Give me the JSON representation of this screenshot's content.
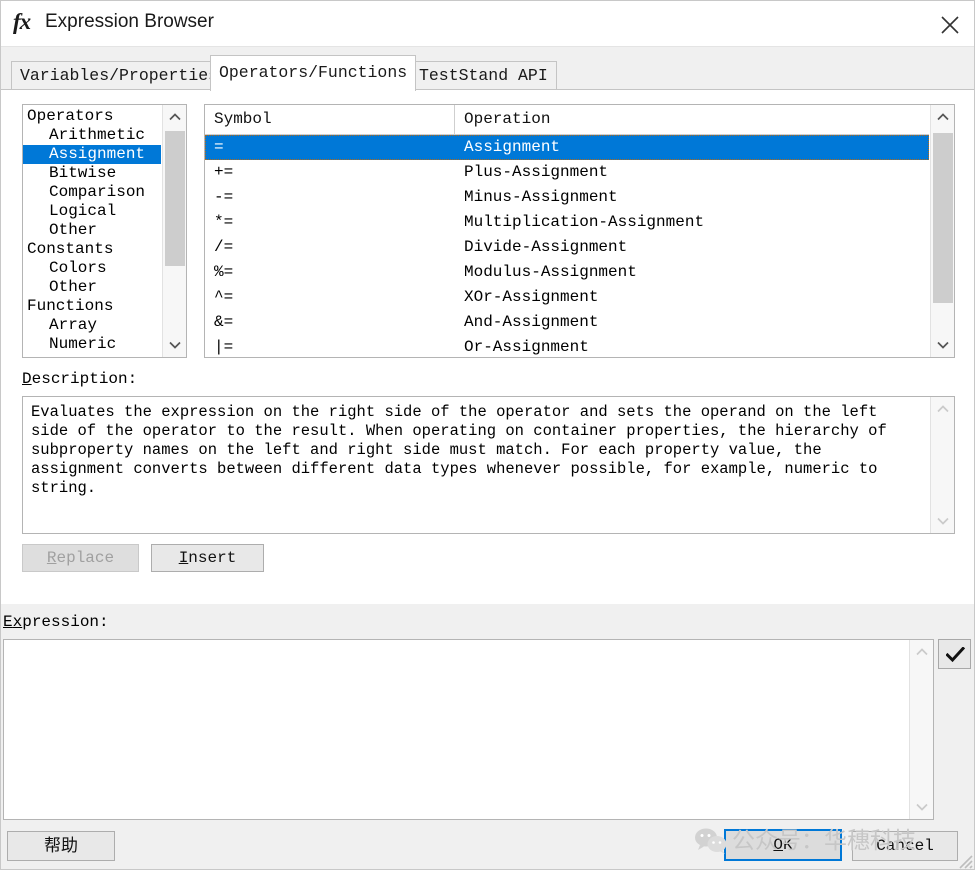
{
  "window": {
    "title": "Expression Browser",
    "fx_icon": "fx-icon",
    "close_icon": "close-icon"
  },
  "tabs": [
    {
      "label": "Variables/Properties",
      "active": false
    },
    {
      "label": "Operators/Functions",
      "active": true
    },
    {
      "label": "TestStand API",
      "active": false
    }
  ],
  "tree": {
    "items": [
      {
        "label": "Operators",
        "level": 0,
        "selected": false
      },
      {
        "label": "Arithmetic",
        "level": 1,
        "selected": false
      },
      {
        "label": "Assignment",
        "level": 1,
        "selected": true
      },
      {
        "label": "Bitwise",
        "level": 1,
        "selected": false
      },
      {
        "label": "Comparison",
        "level": 1,
        "selected": false
      },
      {
        "label": "Logical",
        "level": 1,
        "selected": false
      },
      {
        "label": "Other",
        "level": 1,
        "selected": false
      },
      {
        "label": "Constants",
        "level": 0,
        "selected": false
      },
      {
        "label": "Colors",
        "level": 1,
        "selected": false
      },
      {
        "label": "Other",
        "level": 1,
        "selected": false
      },
      {
        "label": "Functions",
        "level": 0,
        "selected": false
      },
      {
        "label": "Array",
        "level": 1,
        "selected": false
      },
      {
        "label": "Numeric",
        "level": 1,
        "selected": false
      }
    ]
  },
  "list": {
    "columns": [
      "Symbol",
      "Operation"
    ],
    "rows": [
      {
        "symbol": "=",
        "operation": "Assignment",
        "selected": true
      },
      {
        "symbol": "+=",
        "operation": "Plus-Assignment",
        "selected": false
      },
      {
        "symbol": "-=",
        "operation": "Minus-Assignment",
        "selected": false
      },
      {
        "symbol": "*=",
        "operation": "Multiplication-Assignment",
        "selected": false
      },
      {
        "symbol": "/=",
        "operation": "Divide-Assignment",
        "selected": false
      },
      {
        "symbol": "%=",
        "operation": "Modulus-Assignment",
        "selected": false
      },
      {
        "symbol": "^=",
        "operation": "XOr-Assignment",
        "selected": false
      },
      {
        "symbol": "&=",
        "operation": "And-Assignment",
        "selected": false
      },
      {
        "symbol": "|=",
        "operation": "Or-Assignment",
        "selected": false
      }
    ]
  },
  "description": {
    "label": "Description:",
    "label_accel": "D",
    "label_rest": "escription:",
    "text": "Evaluates the expression on the right side of the operator and sets the operand on the left\nside of the operator to the result. When operating on container properties, the hierarchy of\nsubproperty names on the left and right side must match. For each property value, the\nassignment converts between different data types whenever possible, for example, numeric to\nstring."
  },
  "actions": {
    "replace": {
      "accel": "R",
      "rest": "eplace",
      "enabled": false
    },
    "insert": {
      "accel": "I",
      "rest": "nsert",
      "enabled": true
    }
  },
  "expression": {
    "label_accel": "E",
    "label_mid": "x",
    "label_rest": "pression:",
    "value": "",
    "placeholder": "",
    "check_icon": "checkmark-icon"
  },
  "footer": {
    "help": "帮助",
    "ok": {
      "accel": "O",
      "rest": "K"
    },
    "cancel": "Cancel"
  },
  "watermark": {
    "icon": "wechat-icon",
    "text": "公众号：华穗科技"
  },
  "colors": {
    "selection": "#0078d7",
    "focus": "#0078d7",
    "window_bg": "#f0f0f0",
    "panel_bg": "#ffffff",
    "watermark": "#c6c6c6"
  }
}
